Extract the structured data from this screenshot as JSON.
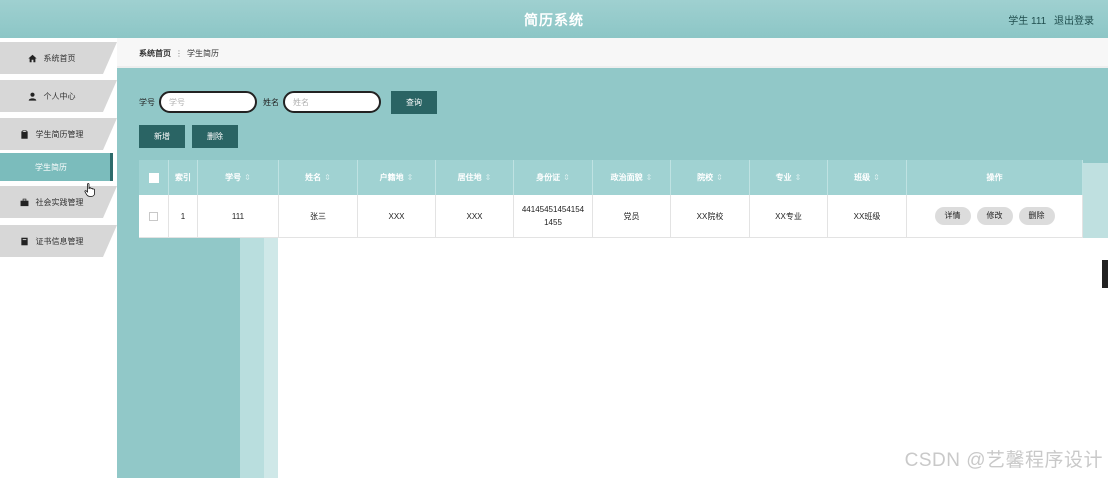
{
  "header": {
    "title": "简历系统",
    "user": "学生 111",
    "logout": "退出登录"
  },
  "sidebar": {
    "items": [
      {
        "label": "系统首页",
        "icon": "home-icon"
      },
      {
        "label": "个人中心",
        "icon": "user-icon"
      },
      {
        "label": "学生简历管理",
        "icon": "clipboard-icon"
      },
      {
        "label": "社会实践管理",
        "icon": "briefcase-icon"
      },
      {
        "label": "证书信息管理",
        "icon": "book-icon"
      }
    ],
    "sub_item": "学生简历"
  },
  "breadcrumb": {
    "home": "系统首页",
    "current": "学生简历"
  },
  "search": {
    "student_no_label": "学号",
    "student_no_placeholder": "学号",
    "name_label": "姓名",
    "name_placeholder": "姓名",
    "query_button": "查询"
  },
  "actions": {
    "add": "新增",
    "delete": "删除"
  },
  "table": {
    "headers": [
      "索引",
      "学号",
      "姓名",
      "户籍地",
      "居住地",
      "身份证",
      "政治面貌",
      "院校",
      "专业",
      "班级",
      "操作"
    ],
    "rows": [
      {
        "index": "1",
        "student_no": "111",
        "name": "张三",
        "hukou": "XXX",
        "residence": "XXX",
        "id_card": "441454514541541455",
        "political": "党员",
        "school": "XX院校",
        "major": "XX专业",
        "class": "XX班级"
      }
    ],
    "row_actions": {
      "detail": "详情",
      "edit": "修改",
      "delete": "删除"
    }
  },
  "watermark": "CSDN @艺馨程序设计",
  "colors": {
    "topbar": "#8cc6c6",
    "main_bg": "#91c8c8",
    "dark_button": "#2a6464",
    "table_header": "#a0d2d2",
    "sidebar_active": "#7bbcbc"
  }
}
